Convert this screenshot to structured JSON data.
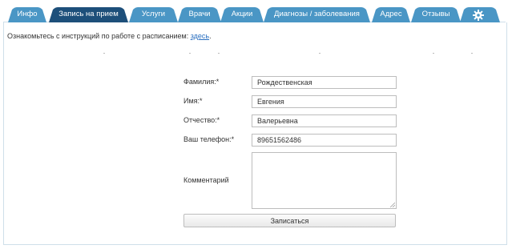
{
  "tabs": [
    {
      "label": "Инфо",
      "active": false
    },
    {
      "label": "Запись на прием",
      "active": true
    },
    {
      "label": "Услуги",
      "active": false
    },
    {
      "label": "Врачи",
      "active": false
    },
    {
      "label": "Акции",
      "active": false
    },
    {
      "label": "Диагнозы / заболевания",
      "active": false
    },
    {
      "label": "Адрес",
      "active": false
    },
    {
      "label": "Отзывы",
      "active": false
    }
  ],
  "settings_icon": "gear-icon",
  "colors": {
    "tab": "#4a96c5",
    "tab_active": "#1d4f7a",
    "panel_border": "#cfdfe9",
    "link": "#2a6fc0"
  },
  "instructions": {
    "text": "Ознакомьтесь с инструкций по работе с расписанием:",
    "link": "здесь",
    "suffix": "."
  },
  "form": {
    "last_name": {
      "label": "Фамилия:*",
      "value": "Рождественская"
    },
    "first_name": {
      "label": "Имя:*",
      "value": "Евгения"
    },
    "patronymic": {
      "label": "Отчество:*",
      "value": "Валерьевна"
    },
    "phone": {
      "label": "Ваш телефон:*",
      "value": "89651562486"
    },
    "comment": {
      "label": "Комментарий",
      "value": ""
    },
    "submit_label": "Записаться"
  }
}
